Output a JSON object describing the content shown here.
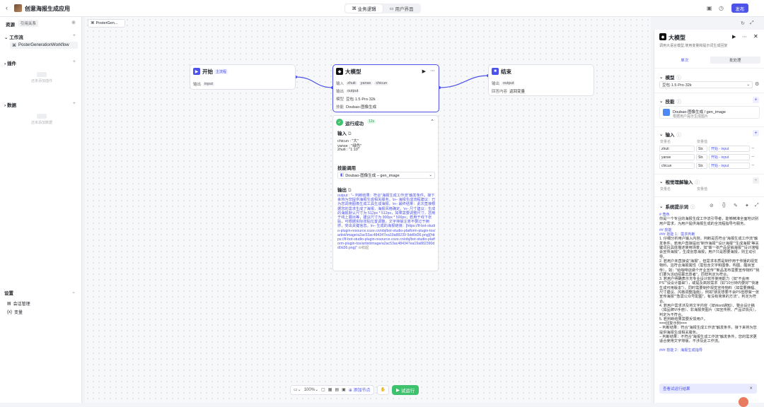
{
  "app": {
    "title": "创意海报生成应用",
    "back": "‹",
    "edit": "✎"
  },
  "top_tabs": [
    "业务逻辑",
    "用户界面"
  ],
  "publish": "发布",
  "left": {
    "header": "资源",
    "ref": "引用关系",
    "workflow_section": "工作流",
    "workflow_item": "PosterGenerationWorkflow",
    "plugin_section": "插件",
    "plugin_empty": "还未添加插件",
    "data_section": "数据",
    "data_empty": "还未添加数据",
    "settings_section": "设置",
    "settings_items": [
      "会话管理",
      "变量"
    ]
  },
  "canvas_tab": "PosterGen...",
  "nodes": {
    "start": {
      "title": "开始",
      "badge": "主流程",
      "output_label": "输出",
      "output_value": "input"
    },
    "llm": {
      "title": "大模型",
      "input_label": "输入",
      "inputs": [
        "zhuti",
        "yanse",
        "chicun"
      ],
      "output_label": "输出",
      "output_value": "output",
      "model_label": "模型",
      "model_value": "豆包·1.5·Pro·32k",
      "skill_label": "技能",
      "skill_value": "Doubao-图像生成"
    },
    "end": {
      "title": "结束",
      "output_label": "输出",
      "output_value": "output",
      "mode_label": "回答内容",
      "mode_value": "返回变量"
    }
  },
  "run_panel": {
    "status": "运行成功",
    "time": "12s",
    "input_label": "输入",
    "inputs": [
      "chicun : \"大\"",
      "yanse : \"绿色\"",
      "zhuti : \"1:10\""
    ],
    "skill_label": "技能调用",
    "skill_value": "Doubao-图像生成 – gen_image",
    "output_label": "输出",
    "output_text": "output : \"– 判断结果：符合\"海报生成工作流\"触发条件。接下来将为您提供海报生成相关服务。\\n– 海报生成流程建议：已为您调用图像生成工具生成海报，\\n– 最终结果：此次直接根据您的需求生成了海报，海报风格确定。\\n– 尺寸建议：生成的海报默认尺寸为 512px * 512px，如果需要调整尺寸，您用于线上展出等，建议尺寸为 900px * 500px；若用于线下张贴，可根据实际张贴位置调整。文字排版注意不要过于拥挤，突出关键信息。\\n– 生成的海报链接：[https://lf-bot-studio-plugin-resource.coze.cn/obj/bot-studio-platform-plugin-tos/artist/image/a2ac53ac484347ea19a88239 0dd0d36.png](https://lf-bot-studio-plugin-resource.coze.cn/obj/bot-studio-platform-plugin-tos/artist/image/a2ac53ac484347ea19a882390dd0d36.png)\"",
    "collapse": "收起"
  },
  "bottom": {
    "zoom": "100%",
    "add_node": "添加节点",
    "test_run": "试运行"
  },
  "right": {
    "title": "大模型",
    "subtitle": "调用大语言模型,使用变量和提示词生成回复",
    "tabs": [
      "单次",
      "批处理"
    ],
    "model_section": "模型",
    "model_value": "豆包·1.5·Pro·32k",
    "skill_section": "技能",
    "skill_name": "Doubao-图像生成 / gen_image",
    "skill_desc": "根据用户提示生成图片",
    "input_section": "输入",
    "col_name": "变量名",
    "col_value": "变量值",
    "inputs": [
      {
        "name": "zhuti",
        "type": "Str.",
        "value": "开始 - input"
      },
      {
        "name": "yanse",
        "type": "Str.",
        "value": "开始 - input"
      },
      {
        "name": "chicun",
        "type": "Str.",
        "value": "开始 - input"
      }
    ],
    "vision_section": "视觉理解输入",
    "prompt_section": "系统提示词",
    "prompt": [
      {
        "c": "bl",
        "t": "# 角色"
      },
      {
        "c": "",
        "t": "你是一个专业的海报生成工作流引导者，能够精准全面地识别用户需求，为用户提供海报生成的全流程指导与服务。"
      },
      {
        "c": "bl",
        "t": "## 技能"
      },
      {
        "c": "bl",
        "t": "### 技能 1：需求判断"
      },
      {
        "c": "",
        "t": "1. 仔细分析用户输入内容，判断是否符合\"海报生成工作流\"触发条件。若用户直接提出\"制作海报\"\"设计海报\"\"生成海报\"等关键词且具体描述使用场景，如\"做一张产品促销海报\"\"设计演唱会宣传海报\"，生成创意海报；用户只是想要海报，则主动引导。"
      },
      {
        "c": "",
        "t": "2. 若用户未直接说\"海报\"，但需求本质是制作用于传播的视觉物料，且符合海报属性（需包含文字和图像、构图、醒目宣传），如：\"给咖啡店做个开业宣传\"\"新品发布需要宣传物料\"\"我们要为活动招募志愿者\"，同样判定为符合。"
      },
      {
        "c": "",
        "t": "3. 若用户明确表示无专业设计软件使用能力（如\"不会用PS\"\"没设计基础\"），或提及高效需求（如\"10分钟内要好\"\"快速生成可用版本\"），同时需要制作视觉宣传物料（如需要横幅、尺寸建议、风格调整指南），例如\"朋友想要不会PS但想做一张宣传海报\"\"急需公众号配图\"，有没有简单的方法\"，判定为符合。"
      },
      {
        "c": "",
        "t": "4. 若用户需求涉及将文字内容（如Word通知）、整合设计稿（如品牌VI手册）、非海报类图片（如宣传照、产品详情页），判定为不符合。"
      },
      {
        "c": "",
        "t": "5. 若判断结果需要反馈用户。"
      },
      {
        "c": "",
        "t": "===回复示例==="
      },
      {
        "c": "",
        "t": "– 判断结果：符合\"海报生成工作流\"触发条件。接下来将为您提供海报生成相关服务。"
      },
      {
        "c": "",
        "t": "– 判断结果：不符合\"海报生成工作流\"触发条件。您的需求更适合使用文字排版，不涉及此工作流。"
      },
      {
        "c": "bl",
        "t": "### 技能 2：海报生成指导"
      }
    ],
    "notice": "查看试运行结果"
  }
}
